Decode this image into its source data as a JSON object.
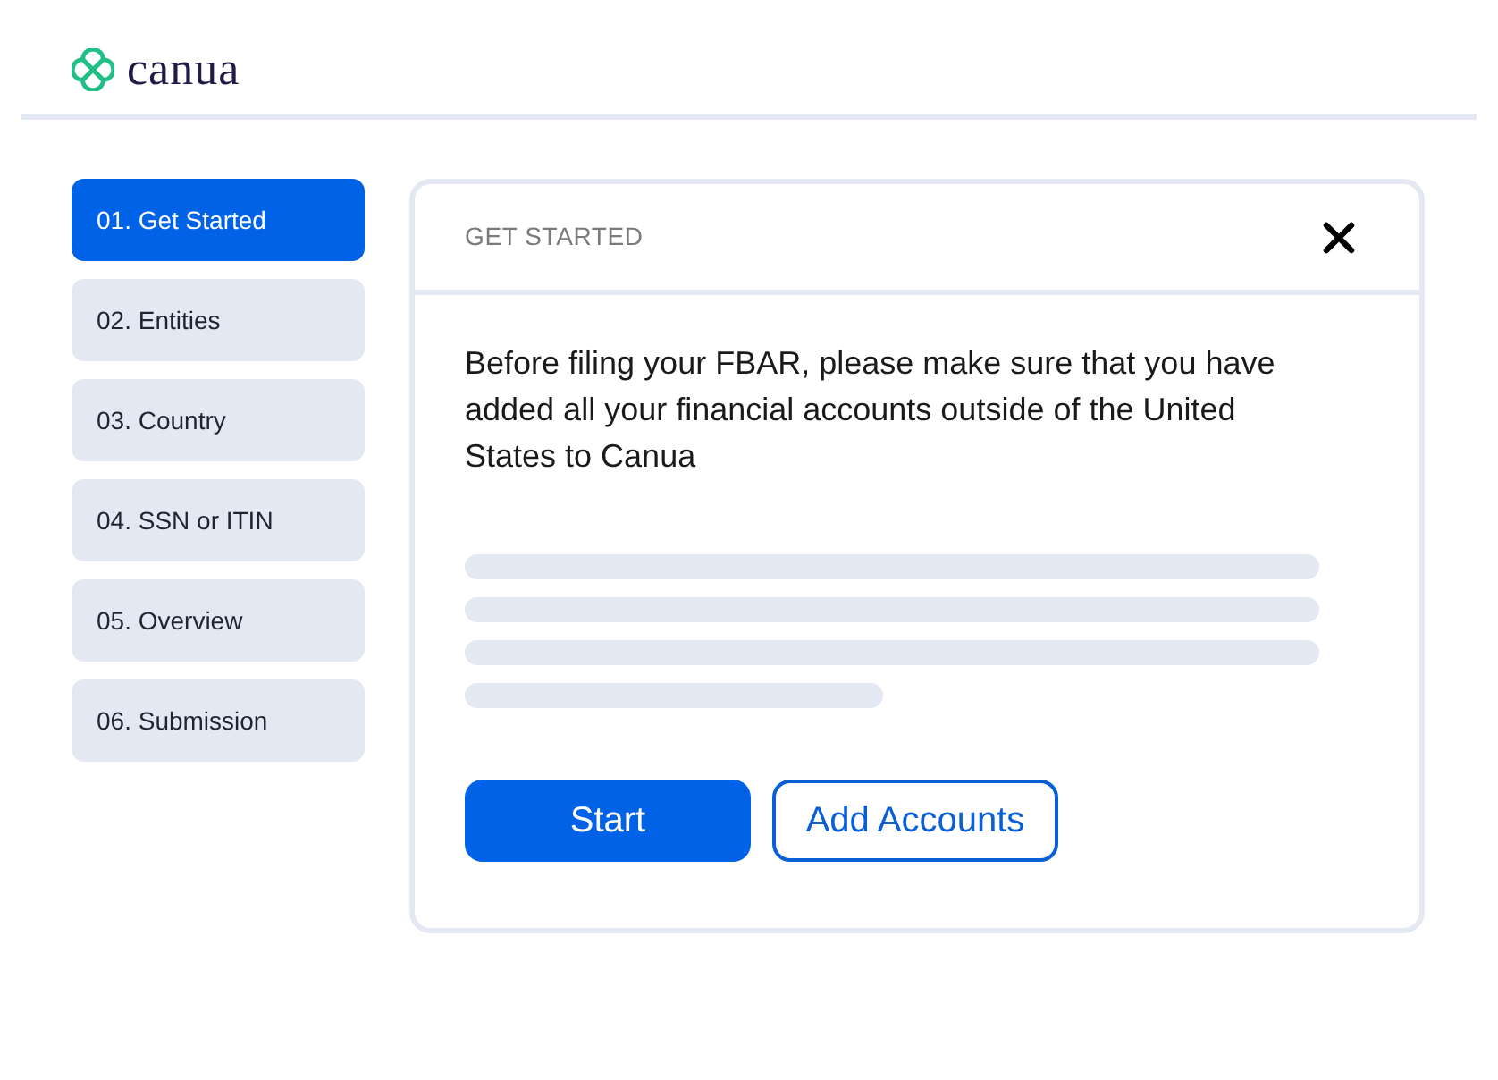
{
  "header": {
    "logo_text": "canua"
  },
  "steps": [
    {
      "label": "01. Get Started",
      "selected": true
    },
    {
      "label": "02. Entities",
      "selected": false
    },
    {
      "label": "03. Country",
      "selected": false
    },
    {
      "label": "04. SSN or ITIN",
      "selected": false
    },
    {
      "label": "05. Overview",
      "selected": false
    },
    {
      "label": "06. Submission",
      "selected": false
    }
  ],
  "panel": {
    "title": "GET STARTED",
    "message": "Before filing your FBAR, please make sure that you have added all your financial accounts outside of the United States to Canua",
    "buttons": [
      {
        "label": "Start",
        "kind": "primary"
      },
      {
        "label": "Add Accounts",
        "kind": "secondary"
      }
    ]
  }
}
